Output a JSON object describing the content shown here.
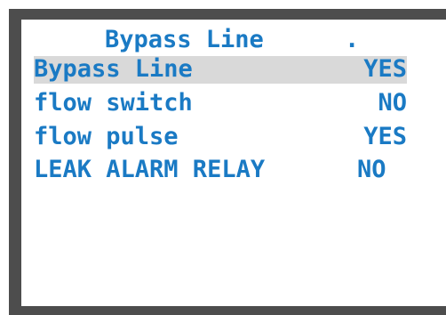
{
  "screen": {
    "title": "Bypass Line",
    "title_marker": ".",
    "rows": [
      {
        "label": "Bypass Line",
        "value": "YES",
        "selected": true
      },
      {
        "label": "flow switch",
        "value": "NO",
        "selected": false
      },
      {
        "label": "flow pulse",
        "value": "YES",
        "selected": false
      },
      {
        "label": "LEAK ALARM RELAY",
        "value": "NO",
        "selected": false
      }
    ]
  },
  "colors": {
    "text": "#1a7ac4",
    "bezel": "#4d4d4d",
    "highlight": "#d9d9d9",
    "background": "#ffffff"
  }
}
